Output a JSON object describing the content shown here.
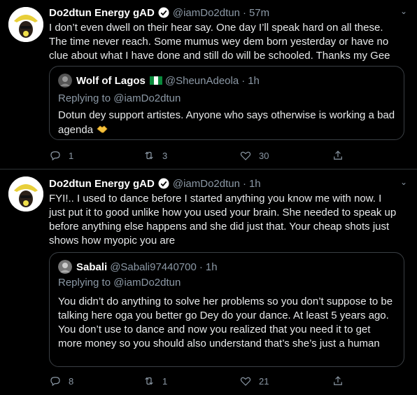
{
  "tweets": [
    {
      "author": "Do2dtun Energy gAD",
      "handle": "@iamDo2dtun",
      "separator": "·",
      "time": "57m",
      "text": "I don’t even dwell on their hear say. One day I’ll speak hard on all these. The time never reach. Some mumus wey dem born yesterday or have no clue about what I have done and still do will be schooled. Thanks my Gee",
      "quote": {
        "author": "Wolf of Lagos",
        "handle": "@SheunAdeola",
        "separator": "·",
        "time": "1h",
        "replying_prefix": "Replying to",
        "replying_to": "@iamDo2dtun",
        "text": "Dotun dey support artistes. Anyone who says otherwise is working a bad agenda"
      },
      "counts": {
        "replies": "1",
        "retweets": "3",
        "likes": "30"
      }
    },
    {
      "author": "Do2dtun Energy gAD",
      "handle": "@iamDo2dtun",
      "separator": "·",
      "time": "1h",
      "text": "FYI!.. I used to dance before I started anything you know me with now. I just put it to good unlike how you used your brain. She needed to speak up before anything else happens and she did just that. Your cheap shots just shows how myopic you are",
      "quote": {
        "author": "Sabali",
        "handle": "@Sabali97440700",
        "separator": "·",
        "time": "1h",
        "replying_prefix": "Replying to",
        "replying_to": "@iamDo2dtun",
        "text": "You didn’t do anything to solve her problems so you don’t suppose to be talking here oga you better go Dey do your dance. At least 5 years ago. You don’t use to dance and now you realized that you need it to get more money so you should also understand that’s she’s just a human"
      },
      "counts": {
        "replies": "8",
        "retweets": "1",
        "likes": "21"
      }
    }
  ],
  "icons": {
    "reply": "reply-icon",
    "retweet": "retweet-icon",
    "like": "heart-icon",
    "share": "share-icon",
    "verified": "verified-badge-icon",
    "caret": "chevron-down-icon",
    "flag": "nigeria-flag-icon",
    "emoji": "handshake-emoji-icon"
  },
  "colors": {
    "background": "#000000",
    "text": "#e7e9ea",
    "muted": "#8b98a5",
    "verified": "#ffffff",
    "border": "#2f3336"
  }
}
